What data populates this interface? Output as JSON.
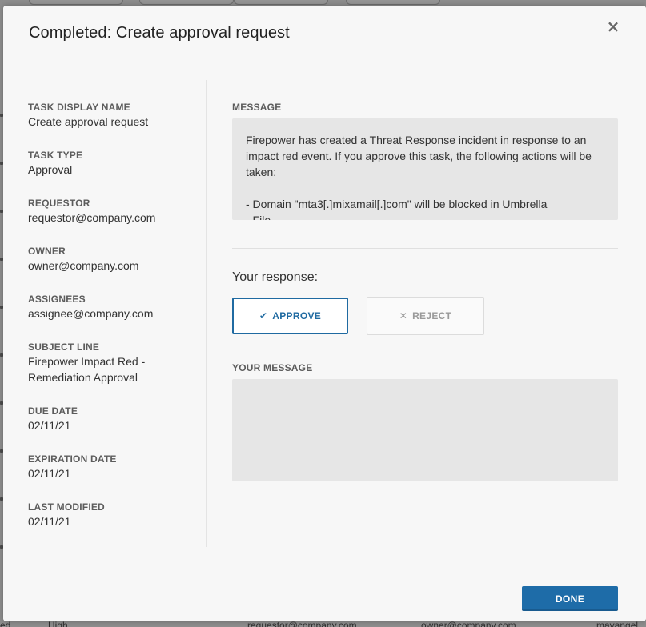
{
  "modal": {
    "title": "Completed: Create approval request",
    "close_icon": "×"
  },
  "details": [
    {
      "label": "TASK DISPLAY NAME",
      "value": "Create approval request"
    },
    {
      "label": "TASK TYPE",
      "value": "Approval"
    },
    {
      "label": "REQUESTOR",
      "value": "requestor@company.com"
    },
    {
      "label": "OWNER",
      "value": "owner@company.com"
    },
    {
      "label": "ASSIGNEES",
      "value": "assignee@company.com"
    },
    {
      "label": "SUBJECT LINE",
      "value": "Firepower Impact Red - Remediation Approval"
    },
    {
      "label": "DUE DATE",
      "value": "02/11/21"
    },
    {
      "label": "EXPIRATION DATE",
      "value": "02/11/21"
    },
    {
      "label": "LAST MODIFIED",
      "value": "02/11/21"
    }
  ],
  "message": {
    "label": "MESSAGE",
    "line1": "Firepower has created a Threat Response incident in response to an impact red event.  If you approve this task, the following actions will be taken:",
    "line2": "- Domain \"mta3[.]mixamail[.]com\" will be blocked in Umbrella",
    "line3": "- File..."
  },
  "response": {
    "label": "Your response:",
    "approve_icon": "✔",
    "approve_label": "APPROVE",
    "reject_icon": "✕",
    "reject_label": "REJECT",
    "selected": "approve"
  },
  "your_message": {
    "label": "YOUR MESSAGE",
    "value": ""
  },
  "footer": {
    "done_label": "DONE"
  },
  "background": {
    "row_cells": [
      "ed",
      "High",
      "requestor@company.com",
      "owner@company.com",
      "mavangel"
    ]
  },
  "colors": {
    "accent": "#1e6ca8",
    "modal_bg": "#f7f7f7",
    "box_bg": "#e6e6e6"
  }
}
